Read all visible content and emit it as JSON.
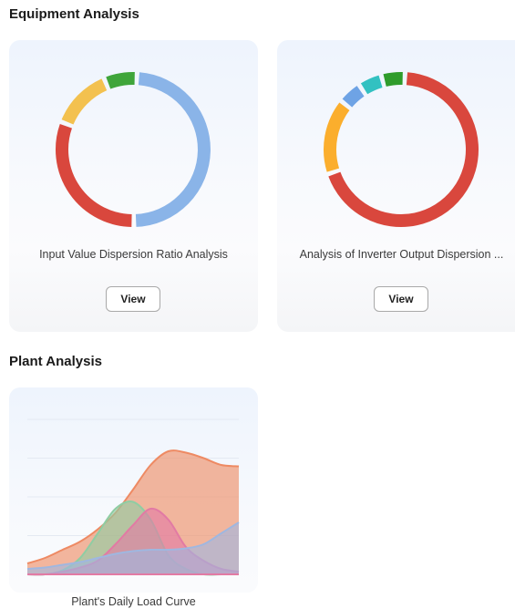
{
  "sections": {
    "equipment": {
      "title": "Equipment Analysis"
    },
    "plant": {
      "title": "Plant Analysis"
    }
  },
  "cards": [
    {
      "label": "Input Value Dispersion Ratio Analysis",
      "button_label": "View",
      "chart_data": {
        "type": "pie",
        "variant": "donut",
        "slices": [
          {
            "value": 49,
            "color": "#8ab4e8"
          },
          {
            "value": 31,
            "color": "#d9473d"
          },
          {
            "value": 13,
            "color": "#f3c14f"
          },
          {
            "value": 7,
            "color": "#3fa53a"
          }
        ]
      }
    },
    {
      "label": "Analysis of Inverter Output Dispersion ...",
      "button_label": "View",
      "chart_data": {
        "type": "pie",
        "variant": "donut",
        "slices": [
          {
            "value": 69,
            "color": "#d9473d"
          },
          {
            "value": 16,
            "color": "#fbae2d"
          },
          {
            "value": 5,
            "color": "#6ea3e5"
          },
          {
            "value": 5,
            "color": "#32c1c1"
          },
          {
            "value": 5,
            "color": "#2f9c2b"
          }
        ]
      }
    }
  ],
  "plant_card": {
    "label": "Plant's Daily Load Curve",
    "chart_data": {
      "type": "area",
      "x": [
        0,
        1,
        2,
        3,
        4,
        5,
        6,
        7,
        8,
        9,
        10,
        11,
        12
      ],
      "series": [
        {
          "color": "#ee8a63",
          "values": [
            8,
            12,
            18,
            24,
            33,
            45,
            62,
            80,
            90,
            89,
            85,
            80,
            79
          ]
        },
        {
          "color": "#8fcda3",
          "values": [
            0,
            0,
            3,
            12,
            30,
            48,
            53,
            40,
            14,
            4,
            0,
            0,
            0
          ]
        },
        {
          "color": "#e27aa4",
          "values": [
            0,
            0,
            2,
            5,
            10,
            22,
            36,
            48,
            40,
            20,
            10,
            4,
            2
          ]
        },
        {
          "color": "#9fb7e0",
          "values": [
            4,
            5,
            7,
            9,
            12,
            15,
            17,
            18,
            18,
            19,
            22,
            30,
            38
          ]
        }
      ],
      "ylim": [
        0,
        100
      ],
      "grid": true
    }
  }
}
